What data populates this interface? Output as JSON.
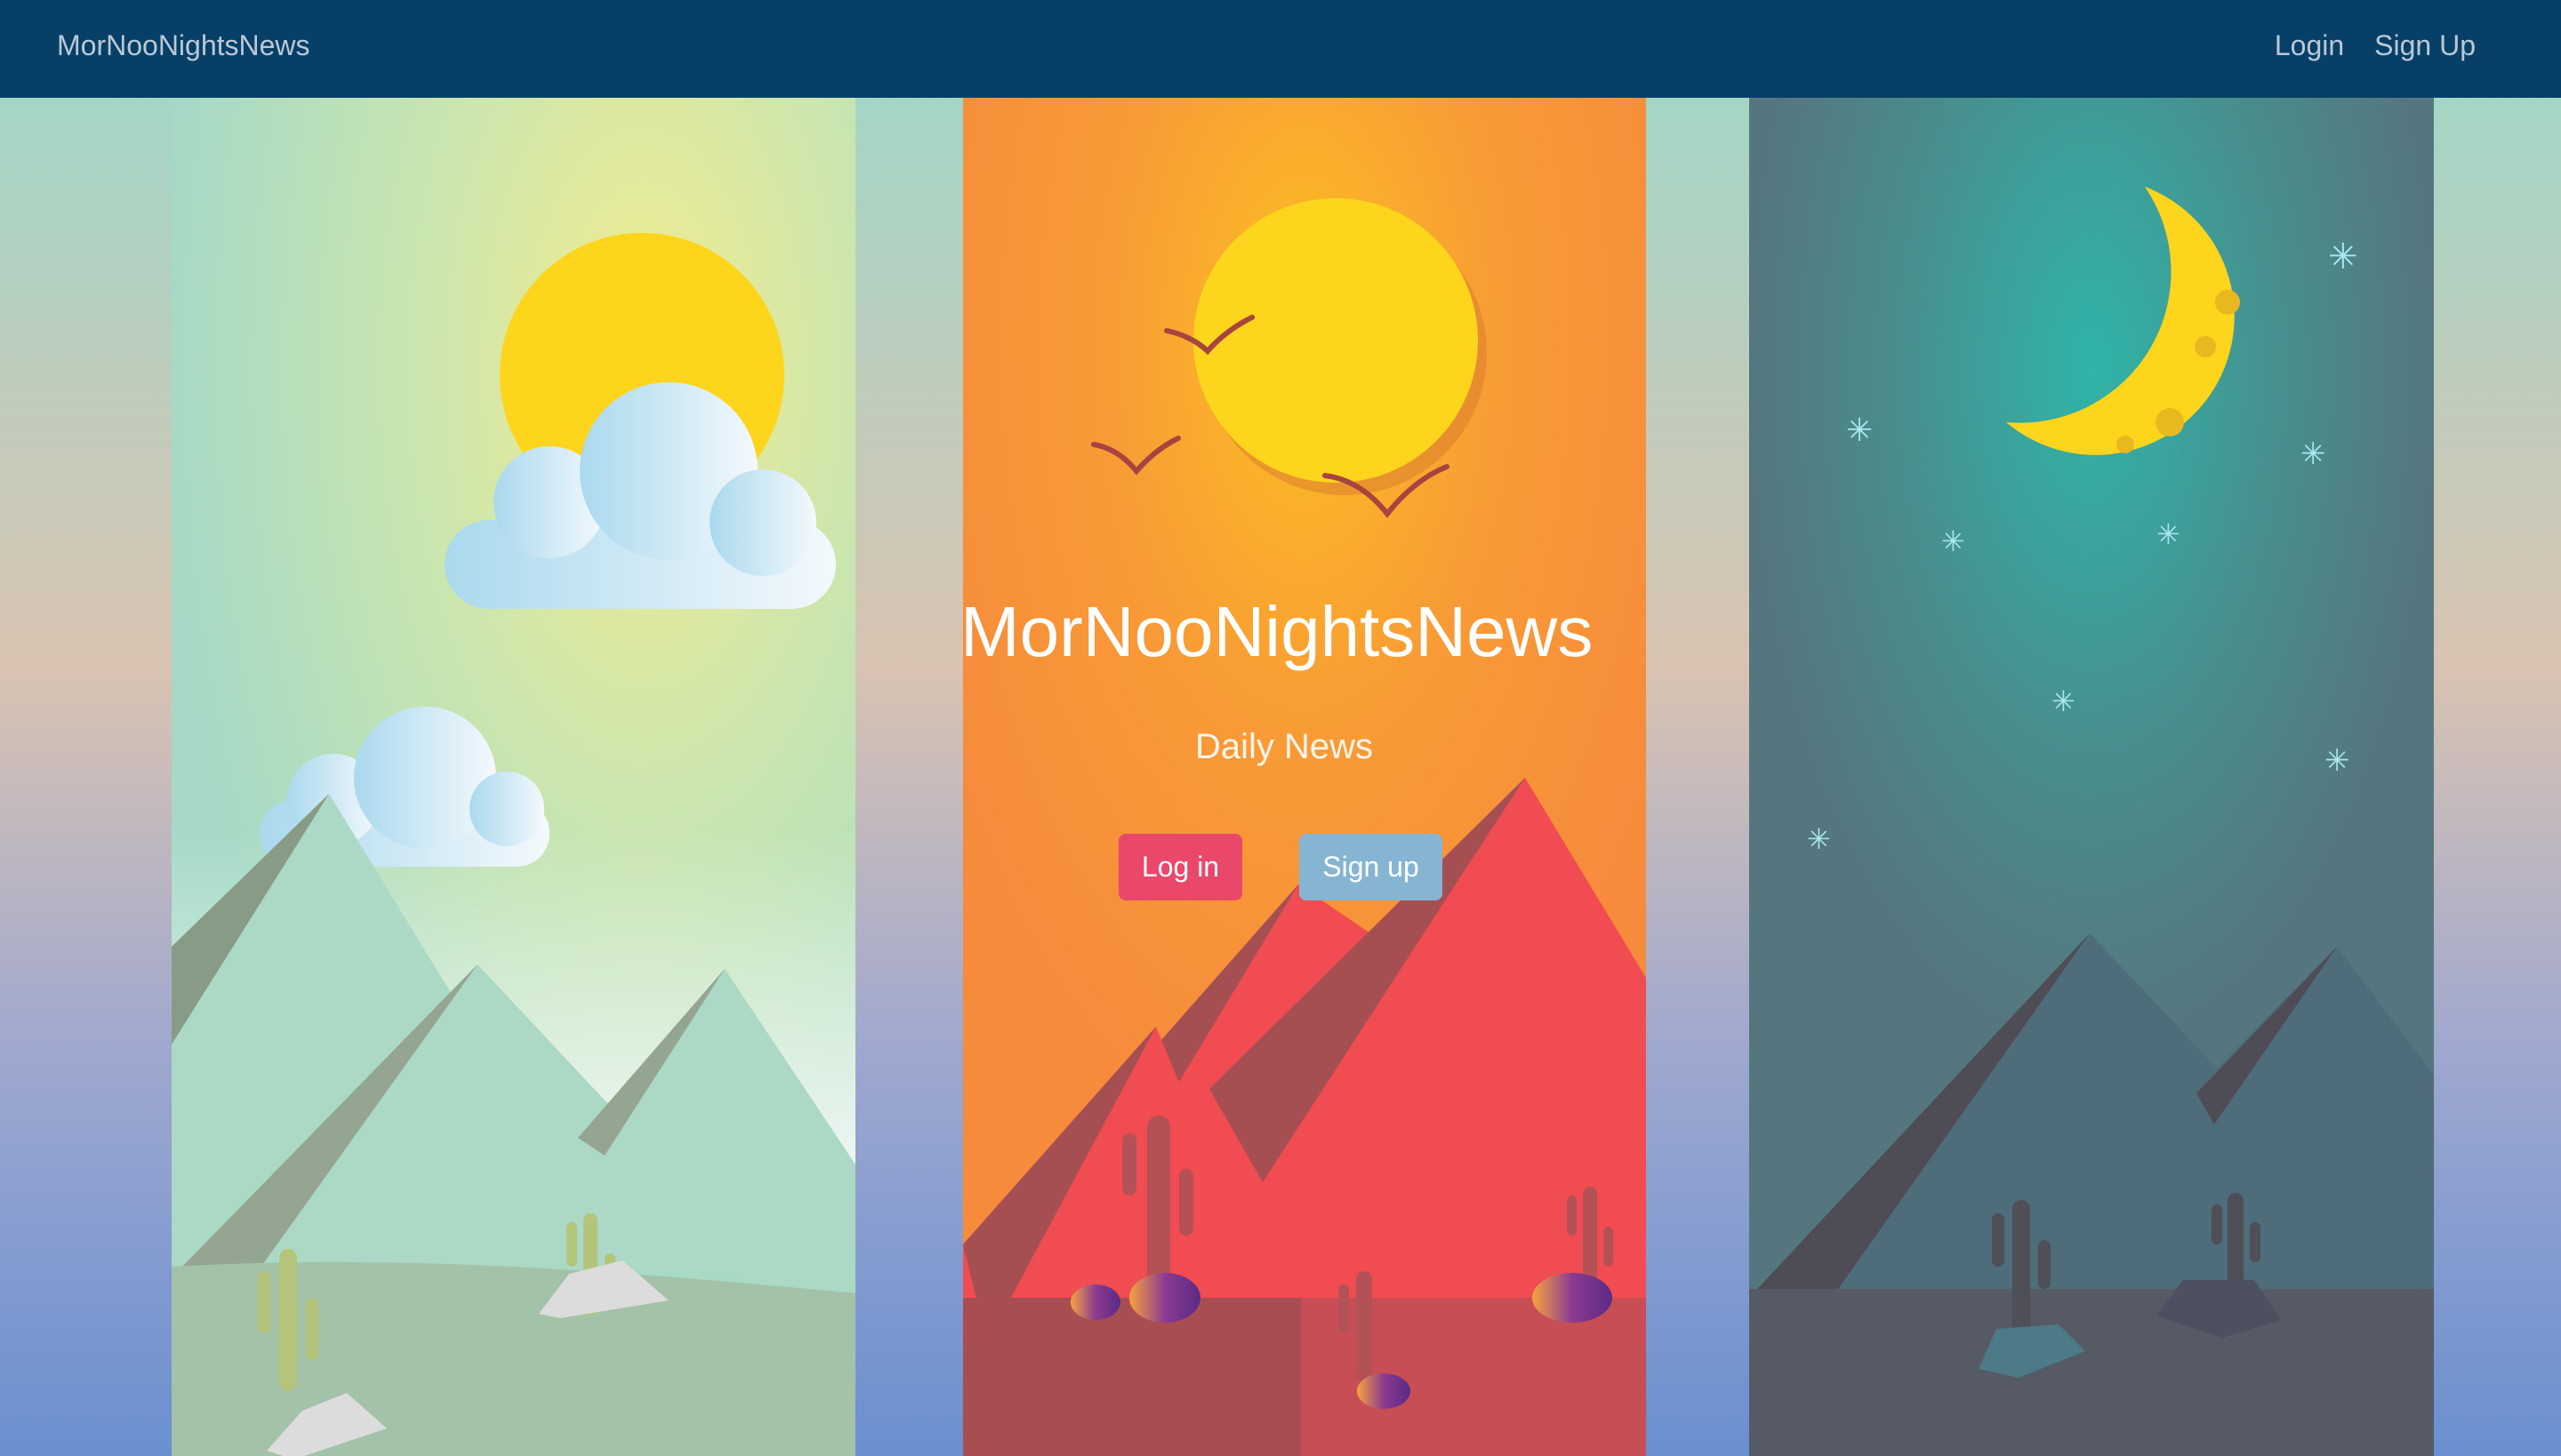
{
  "navbar": {
    "brand": "MorNooNightsNews",
    "links": [
      {
        "label": "Login"
      },
      {
        "label": "Sign Up"
      }
    ]
  },
  "hero": {
    "title": "MorNooNightsNews",
    "subtitle": "Daily News",
    "login_button": "Log in",
    "signup_button": "Sign up"
  },
  "colors": {
    "navbar": "#073f66",
    "morning": "#a9dcc8",
    "noon": "#f68b3c",
    "night": "#55767f",
    "sun": "#fdd51d",
    "login_button": "#e9486b",
    "signup_button": "#86b5d3"
  }
}
